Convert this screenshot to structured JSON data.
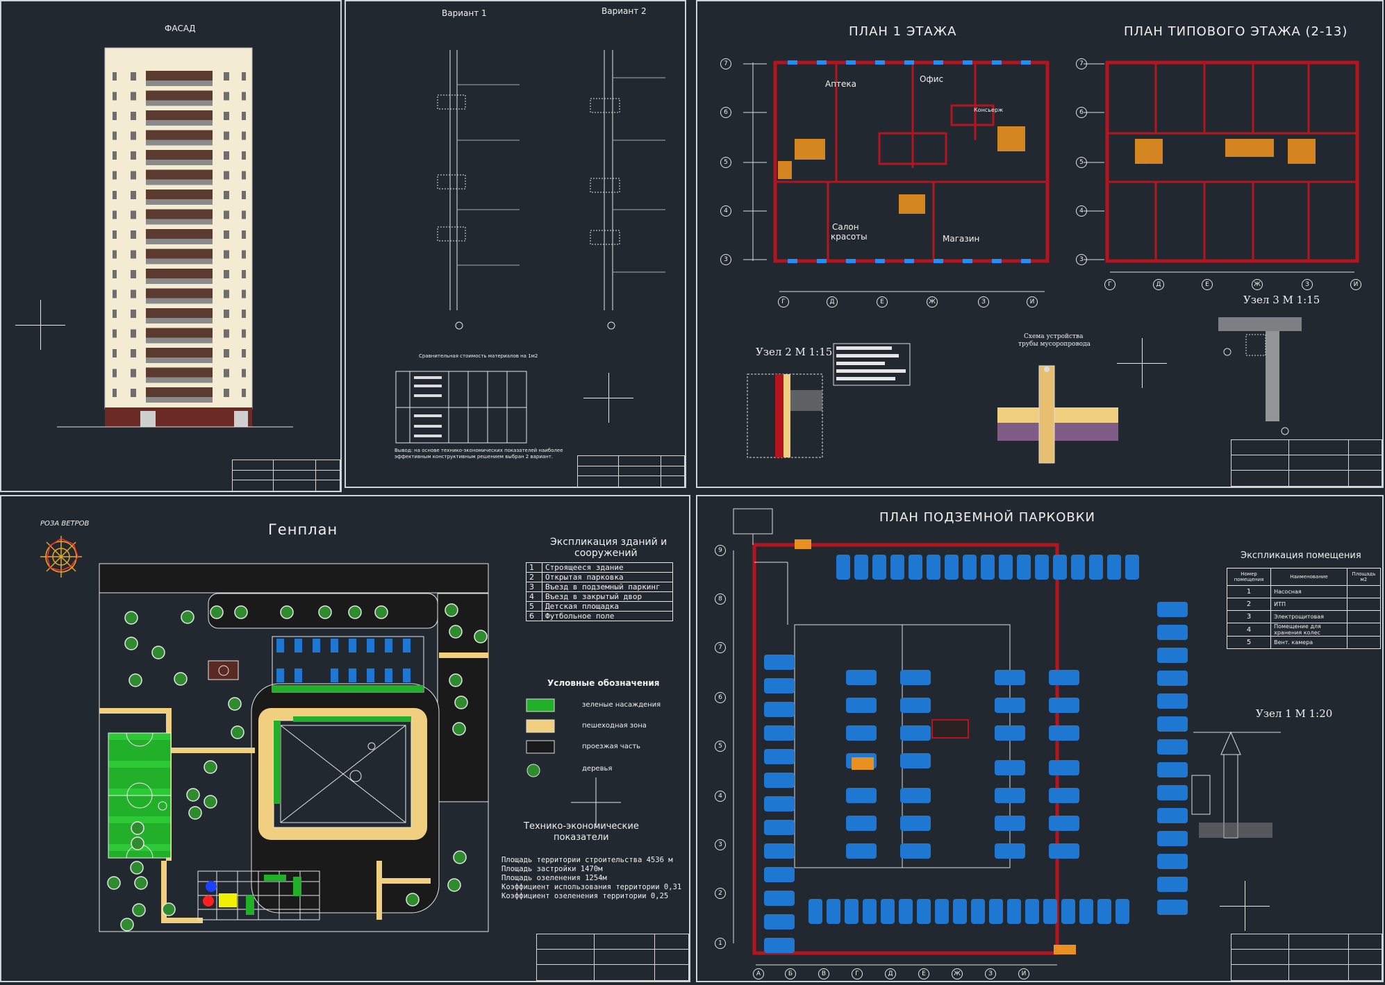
{
  "facade": {
    "title": "ФАСАД"
  },
  "wall_sections": {
    "variant1": "Вариант 1",
    "variant2": "Вариант 2",
    "table_title": "Сравнительная стоимость материалов на 1м2",
    "conclusion_line1": "Вывод: на основе технико-экономических показателей наиболее",
    "conclusion_line2": "эффективным конструктивным решением выбран 2 вариант."
  },
  "plans": {
    "floor1_title": "ПЛАН 1 ЭТАЖА",
    "typical_title": "ПЛАН ТИПОВОГО ЭТАЖА (2-13)",
    "rooms": {
      "apteka": "Аптека",
      "ofis": "Офис",
      "salon_line1": "Салон",
      "salon_line2": "красоты",
      "magazin": "Магазин",
      "konsierzh": "Консьерж"
    },
    "axes_rows_left": [
      "7",
      "6",
      "5",
      "4",
      "3"
    ],
    "axes_cols_left": [
      "Г",
      "Д",
      "Е",
      "Ж",
      "З",
      "И"
    ],
    "axes_cols_right": [
      "Г",
      "Д",
      "Е",
      "Ж",
      "З",
      "И"
    ],
    "uzel2": "Узел 2 М 1:15",
    "uzel3": "Узел 3 М 1:15",
    "chute_line1": "Схема устройства",
    "chute_line2": "трубы мусоропровода"
  },
  "genplan": {
    "title": "Генплан",
    "wind_rose": "РОЗА ВЕТРОВ",
    "explication_title_line1": "Экспликация  зданий и",
    "explication_title_line2": "сооружений",
    "explication": [
      {
        "n": "1",
        "name": "Строящееся здание"
      },
      {
        "n": "2",
        "name": "Открытая парковка"
      },
      {
        "n": "3",
        "name": "Въезд в подземный паркинг"
      },
      {
        "n": "4",
        "name": "Въезд в закрытый двор"
      },
      {
        "n": "5",
        "name": "Детская площадка"
      },
      {
        "n": "6",
        "name": "Футбольное поле"
      }
    ],
    "legend_title": "Условные обозначения",
    "legend": [
      {
        "label": "зеленые насаждения",
        "color": "#22b02b"
      },
      {
        "label": "пешеходная зона",
        "color": "#f0d080"
      },
      {
        "label": "проезжая часть",
        "color": "#1a1a1a"
      },
      {
        "label": "деревья",
        "color": "#2e8b2e"
      }
    ],
    "tep_title_line1": "Технико-экономические",
    "tep_title_line2": "показатели",
    "tep": [
      "Площадь территории строительства  4536 м",
      "Площадь  застройки    1470м",
      "Площадь  озеленения     1254м",
      "Коэффициент  использования  территории  0,31",
      "Коэффициент  озеленения  территории     0,25"
    ]
  },
  "parking": {
    "title": "ПЛАН ПОДЗЕМНОЙ ПАРКОВКИ",
    "explication_title": "Экспликация  помещения",
    "explication_headers": [
      "Номер помещения",
      "Наименование",
      "Площадь м2"
    ],
    "explication": [
      {
        "n": "1",
        "name": "Насосная"
      },
      {
        "n": "2",
        "name": "ИТП"
      },
      {
        "n": "3",
        "name": "Электрощитовая"
      },
      {
        "n": "4",
        "name": "Помещение для хранения колес"
      },
      {
        "n": "5",
        "name": "Вент. камера"
      }
    ],
    "uzel1": "Узел 1 М 1:20",
    "axes_rows": [
      "9",
      "8",
      "7",
      "6",
      "5",
      "4",
      "3",
      "2",
      "1"
    ],
    "axes_cols": [
      "А",
      "Б",
      "В",
      "Г",
      "Д",
      "Е",
      "Ж",
      "З",
      "И"
    ]
  },
  "colors": {
    "background": "#212830",
    "wall_red": "#b4141e",
    "car_blue": "#1e78d2",
    "green": "#22b02b",
    "sand": "#f0d080",
    "orange": "#e89020",
    "brick": "#5a2a22"
  }
}
